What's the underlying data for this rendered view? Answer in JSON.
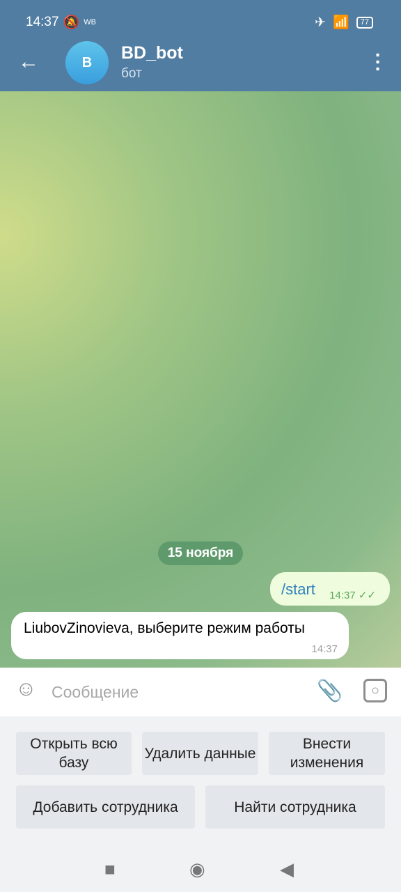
{
  "status_bar": {
    "time": "14:37",
    "carrier_badge": "WB",
    "battery": "77"
  },
  "header": {
    "avatar_letter": "B",
    "title": "BD_bot",
    "subtitle": "бот"
  },
  "chat": {
    "date_badge": "15 ноября",
    "messages": [
      {
        "direction": "outgoing",
        "text": "/start",
        "time": "14:37",
        "read": true
      },
      {
        "direction": "incoming",
        "text": "LiubovZinovieva, выберите режим работы",
        "time": "14:37"
      }
    ]
  },
  "composer": {
    "placeholder": "Сообщение"
  },
  "keyboard": {
    "buttons": [
      "Открыть всю базу",
      "Удалить данные",
      "Внести изменения",
      "Добавить сотрудника",
      "Найти сотрудника"
    ]
  },
  "colors": {
    "header": "#517da2",
    "outgoing_bubble": "#effdde",
    "date_badge": "#5f9a6c"
  }
}
